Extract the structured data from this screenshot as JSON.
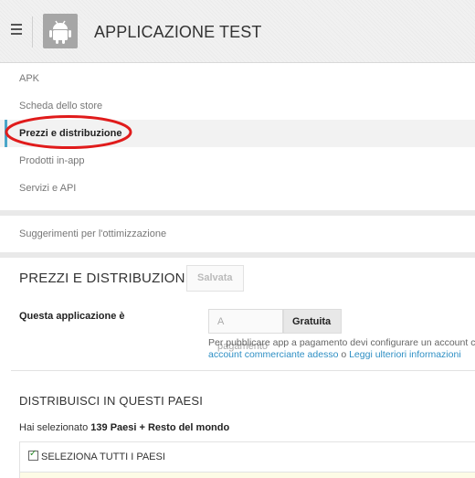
{
  "header": {
    "app_title": "APPLICAZIONE TEST"
  },
  "nav": {
    "items": [
      {
        "label": "APK"
      },
      {
        "label": "Scheda dello store"
      },
      {
        "label": "Prezzi e distribuzione",
        "active": true
      },
      {
        "label": "Prodotti in-app"
      },
      {
        "label": "Servizi e API"
      }
    ],
    "secondary": {
      "label": "Suggerimenti per l'ottimizzazione"
    }
  },
  "pricing": {
    "title": "PREZZI E DISTRIBUZIONE",
    "status_label": "Salvata",
    "question_label": "Questa applicazione è",
    "options": {
      "paid": "A pagamento",
      "free": "Gratuita",
      "selected": "Gratuita"
    },
    "info_line1": "Per pubblicare app a pagamento devi configurare un account co",
    "info_link1": "account commerciante adesso",
    "info_or": " o ",
    "info_link2": "Leggi ulteriori informazioni"
  },
  "distribution": {
    "title": "DISTRIBUISCI IN QUESTI PAESI",
    "selected_prefix": "Hai selezionato ",
    "selected_value": "139 Paesi + Resto del mondo",
    "select_all_label": "SELEZIONA TUTTI I PAESI",
    "select_all_checked": true
  },
  "colors": {
    "accent": "#4aa6c9",
    "link": "#2e8fc4",
    "annotation": "#e01b1b"
  }
}
